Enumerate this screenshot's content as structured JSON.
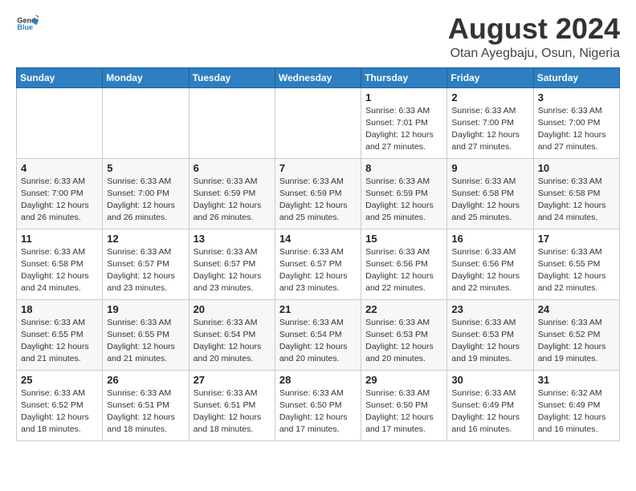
{
  "logo": {
    "text_general": "General",
    "text_blue": "Blue"
  },
  "title": "August 2024",
  "location": "Otan Ayegbaju, Osun, Nigeria",
  "days_of_week": [
    "Sunday",
    "Monday",
    "Tuesday",
    "Wednesday",
    "Thursday",
    "Friday",
    "Saturday"
  ],
  "weeks": [
    [
      {
        "day": "",
        "info": ""
      },
      {
        "day": "",
        "info": ""
      },
      {
        "day": "",
        "info": ""
      },
      {
        "day": "",
        "info": ""
      },
      {
        "day": "1",
        "info": "Sunrise: 6:33 AM\nSunset: 7:01 PM\nDaylight: 12 hours\nand 27 minutes."
      },
      {
        "day": "2",
        "info": "Sunrise: 6:33 AM\nSunset: 7:00 PM\nDaylight: 12 hours\nand 27 minutes."
      },
      {
        "day": "3",
        "info": "Sunrise: 6:33 AM\nSunset: 7:00 PM\nDaylight: 12 hours\nand 27 minutes."
      }
    ],
    [
      {
        "day": "4",
        "info": "Sunrise: 6:33 AM\nSunset: 7:00 PM\nDaylight: 12 hours\nand 26 minutes."
      },
      {
        "day": "5",
        "info": "Sunrise: 6:33 AM\nSunset: 7:00 PM\nDaylight: 12 hours\nand 26 minutes."
      },
      {
        "day": "6",
        "info": "Sunrise: 6:33 AM\nSunset: 6:59 PM\nDaylight: 12 hours\nand 26 minutes."
      },
      {
        "day": "7",
        "info": "Sunrise: 6:33 AM\nSunset: 6:59 PM\nDaylight: 12 hours\nand 25 minutes."
      },
      {
        "day": "8",
        "info": "Sunrise: 6:33 AM\nSunset: 6:59 PM\nDaylight: 12 hours\nand 25 minutes."
      },
      {
        "day": "9",
        "info": "Sunrise: 6:33 AM\nSunset: 6:58 PM\nDaylight: 12 hours\nand 25 minutes."
      },
      {
        "day": "10",
        "info": "Sunrise: 6:33 AM\nSunset: 6:58 PM\nDaylight: 12 hours\nand 24 minutes."
      }
    ],
    [
      {
        "day": "11",
        "info": "Sunrise: 6:33 AM\nSunset: 6:58 PM\nDaylight: 12 hours\nand 24 minutes."
      },
      {
        "day": "12",
        "info": "Sunrise: 6:33 AM\nSunset: 6:57 PM\nDaylight: 12 hours\nand 23 minutes."
      },
      {
        "day": "13",
        "info": "Sunrise: 6:33 AM\nSunset: 6:57 PM\nDaylight: 12 hours\nand 23 minutes."
      },
      {
        "day": "14",
        "info": "Sunrise: 6:33 AM\nSunset: 6:57 PM\nDaylight: 12 hours\nand 23 minutes."
      },
      {
        "day": "15",
        "info": "Sunrise: 6:33 AM\nSunset: 6:56 PM\nDaylight: 12 hours\nand 22 minutes."
      },
      {
        "day": "16",
        "info": "Sunrise: 6:33 AM\nSunset: 6:56 PM\nDaylight: 12 hours\nand 22 minutes."
      },
      {
        "day": "17",
        "info": "Sunrise: 6:33 AM\nSunset: 6:55 PM\nDaylight: 12 hours\nand 22 minutes."
      }
    ],
    [
      {
        "day": "18",
        "info": "Sunrise: 6:33 AM\nSunset: 6:55 PM\nDaylight: 12 hours\nand 21 minutes."
      },
      {
        "day": "19",
        "info": "Sunrise: 6:33 AM\nSunset: 6:55 PM\nDaylight: 12 hours\nand 21 minutes."
      },
      {
        "day": "20",
        "info": "Sunrise: 6:33 AM\nSunset: 6:54 PM\nDaylight: 12 hours\nand 20 minutes."
      },
      {
        "day": "21",
        "info": "Sunrise: 6:33 AM\nSunset: 6:54 PM\nDaylight: 12 hours\nand 20 minutes."
      },
      {
        "day": "22",
        "info": "Sunrise: 6:33 AM\nSunset: 6:53 PM\nDaylight: 12 hours\nand 20 minutes."
      },
      {
        "day": "23",
        "info": "Sunrise: 6:33 AM\nSunset: 6:53 PM\nDaylight: 12 hours\nand 19 minutes."
      },
      {
        "day": "24",
        "info": "Sunrise: 6:33 AM\nSunset: 6:52 PM\nDaylight: 12 hours\nand 19 minutes."
      }
    ],
    [
      {
        "day": "25",
        "info": "Sunrise: 6:33 AM\nSunset: 6:52 PM\nDaylight: 12 hours\nand 18 minutes."
      },
      {
        "day": "26",
        "info": "Sunrise: 6:33 AM\nSunset: 6:51 PM\nDaylight: 12 hours\nand 18 minutes."
      },
      {
        "day": "27",
        "info": "Sunrise: 6:33 AM\nSunset: 6:51 PM\nDaylight: 12 hours\nand 18 minutes."
      },
      {
        "day": "28",
        "info": "Sunrise: 6:33 AM\nSunset: 6:50 PM\nDaylight: 12 hours\nand 17 minutes."
      },
      {
        "day": "29",
        "info": "Sunrise: 6:33 AM\nSunset: 6:50 PM\nDaylight: 12 hours\nand 17 minutes."
      },
      {
        "day": "30",
        "info": "Sunrise: 6:33 AM\nSunset: 6:49 PM\nDaylight: 12 hours\nand 16 minutes."
      },
      {
        "day": "31",
        "info": "Sunrise: 6:32 AM\nSunset: 6:49 PM\nDaylight: 12 hours\nand 16 minutes."
      }
    ]
  ]
}
